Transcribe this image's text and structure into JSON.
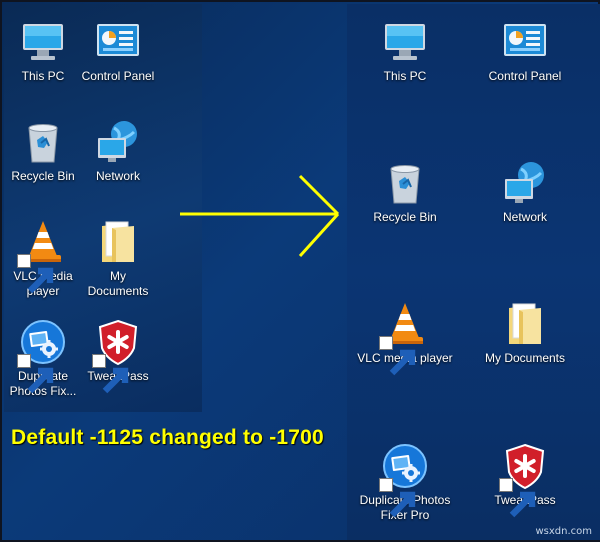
{
  "before": {
    "icons": [
      {
        "label": "This PC",
        "icon": "this-pc-icon"
      },
      {
        "label": "Control Panel",
        "icon": "control-panel-icon"
      },
      {
        "label": "Recycle Bin",
        "icon": "recycle-bin-icon"
      },
      {
        "label": "Network",
        "icon": "network-icon"
      },
      {
        "label": "VLC media player",
        "icon": "vlc-icon"
      },
      {
        "label": "My Documents",
        "icon": "folder-icon"
      },
      {
        "label": "Duplicate Photos Fix...",
        "icon": "duplicate-photos-icon"
      },
      {
        "label": "TweakPass",
        "icon": "tweakpass-icon"
      }
    ]
  },
  "after": {
    "icons": [
      {
        "label": "This PC",
        "icon": "this-pc-icon"
      },
      {
        "label": "Control Panel",
        "icon": "control-panel-icon"
      },
      {
        "label": "Recycle Bin",
        "icon": "recycle-bin-icon"
      },
      {
        "label": "Network",
        "icon": "network-icon"
      },
      {
        "label": "VLC media player",
        "icon": "vlc-icon"
      },
      {
        "label": "My Documents",
        "icon": "folder-icon"
      },
      {
        "label": "Duplicate Photos Fixer Pro",
        "icon": "duplicate-photos-icon"
      },
      {
        "label": "TweakPass",
        "icon": "tweakpass-icon"
      }
    ]
  },
  "caption": "Default -1125 changed to -1700",
  "watermark": "wsxdn.com",
  "colors": {
    "caption": "#ffff00",
    "arrow": "#ffff00",
    "desktop": "#0a2f63"
  }
}
